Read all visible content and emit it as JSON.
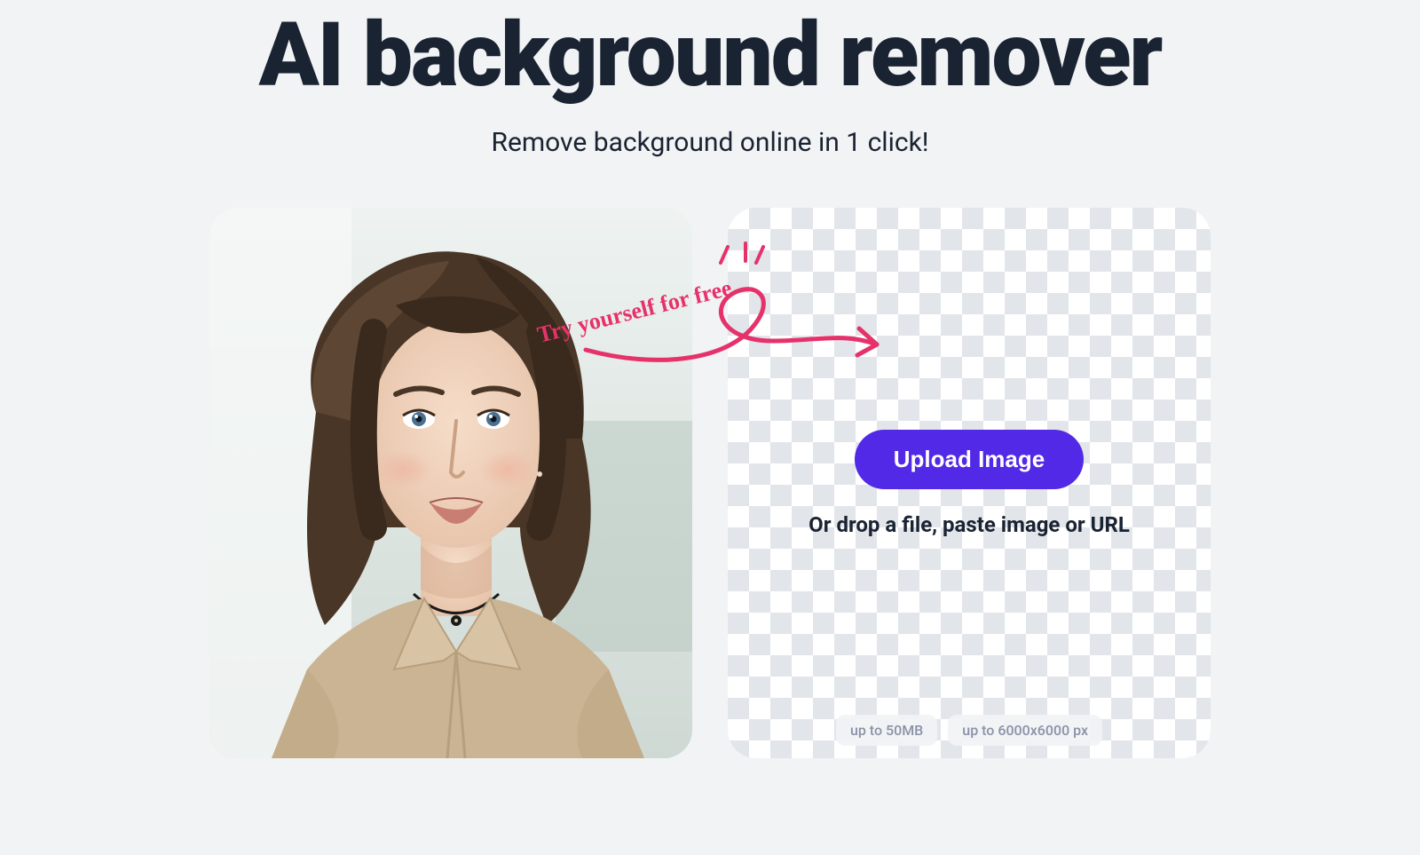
{
  "hero": {
    "title": "AI background remover",
    "subtitle": "Remove background online in 1 click!"
  },
  "callout": {
    "text": "Try yourself for free"
  },
  "dropzone": {
    "upload_label": "Upload Image",
    "drop_text": "Or drop a file, paste image or URL",
    "limits": {
      "size": "up to 50MB",
      "dimensions": "up to 6000x6000 px"
    }
  },
  "colors": {
    "accent": "#5129e6",
    "callout": "#e6326a",
    "text": "#1a2332",
    "bg": "#f1f3f5"
  }
}
